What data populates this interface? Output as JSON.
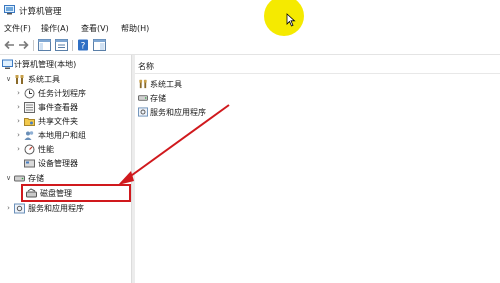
{
  "window": {
    "title": "计算机管理"
  },
  "menu": [
    "文件(F)",
    "操作(A)",
    "查看(V)",
    "帮助(H)"
  ],
  "tree": {
    "root": "计算机管理(本地)",
    "system_tools": "系统工具",
    "task_scheduler": "任务计划程序",
    "event_viewer": "事件查看器",
    "shared_folders": "共享文件夹",
    "local_users": "本地用户和组",
    "performance": "性能",
    "device_manager": "设备管理器",
    "storage": "存储",
    "disk_management": "磁盘管理",
    "services_apps": "服务和应用程序"
  },
  "list": {
    "header": "名称",
    "items": [
      "系统工具",
      "存储",
      "服务和应用程序"
    ]
  },
  "colors": {
    "annotation": "#d0191d",
    "cursor_highlight": "#f5ea00"
  }
}
